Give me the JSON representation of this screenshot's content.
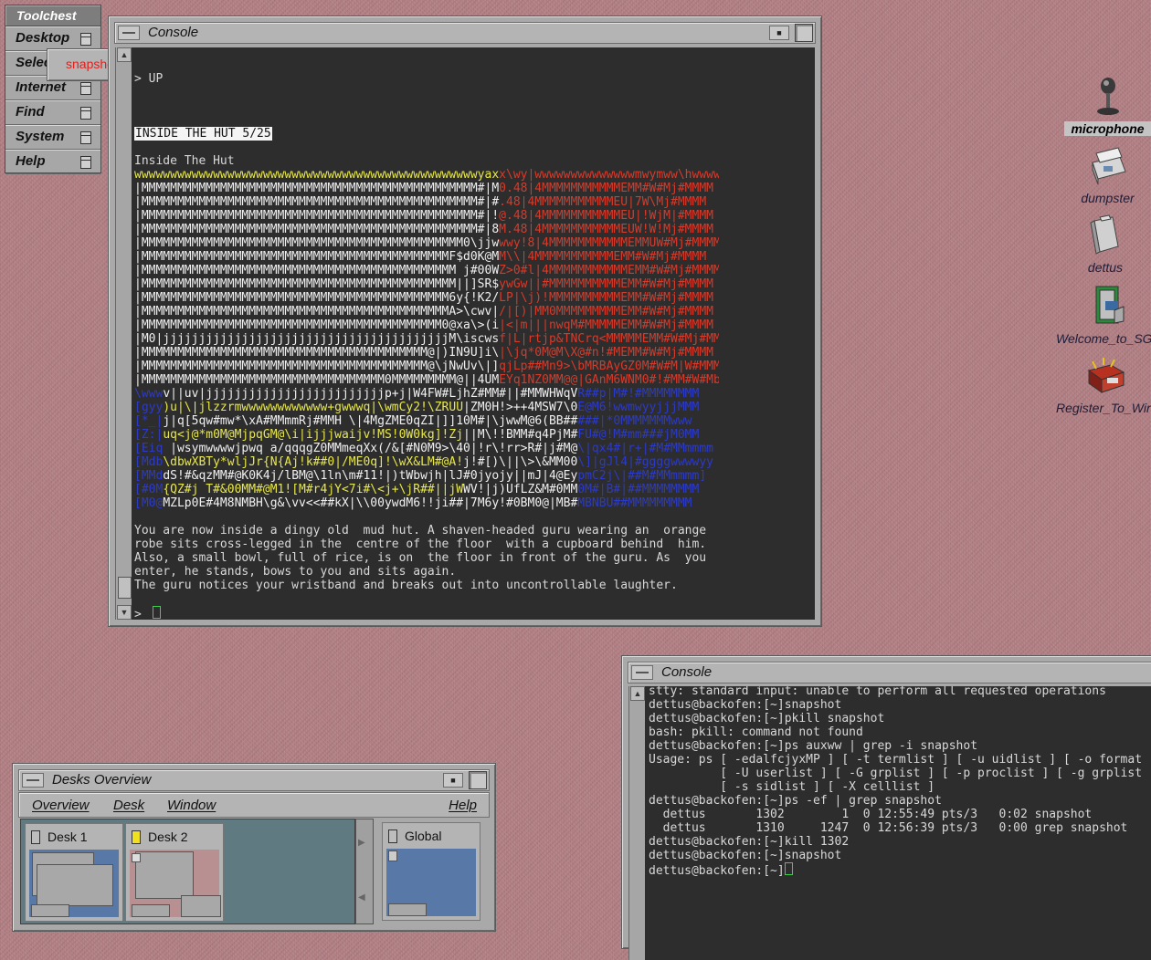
{
  "toolchest": {
    "title": "Toolchest",
    "items": [
      {
        "label": "Desktop"
      },
      {
        "label": "Selected"
      },
      {
        "label": "Internet"
      },
      {
        "label": "Find"
      },
      {
        "label": "System"
      },
      {
        "label": "Help"
      }
    ],
    "submenu_item": "snapshot"
  },
  "console_main": {
    "title": "Console",
    "pre_text": "> UP",
    "room_banner": "INSIDE THE HUT 5/25",
    "room_name": "Inside The Hut",
    "ascii_art": [
      "wwwwwwwwwwwwwwwwwwwwwwwwwwwwwwwwwwwwwwwwwwwwwwwwyaxx\\wy|wwwwwwwwwwwwwwmwymww\\hwwwww",
      "|MMMMMMMMMMMMMMMMMMMMMMMMMMMMMMMMMMMMMMMMMMMMMMM#|M0.48|4MMMMMMMMMMMEMM#W#Mj#MMMM",
      "|MMMMMMMMMMMMMMMMMMMMMMMMMMMMMMMMMMMMMMMMMMMMMMM#|#.48|4MMMMMMMMMMMEU|7W\\Mj#MMMM",
      "|MMMMMMMMMMMMMMMMMMMMMMMMMMMMMMMMMMMMMMMMMMMMMMM#|!@.48|4MMMMMMMMMMMEU|!WjM|#MMMM",
      "|MMMMMMMMMMMMMMMMMMMMMMMMMMMMMMMMMMMMMMMMMMMMMMM#|8M.48|4MMMMMMMMMMMEUW!W!Mj#MMMM",
      "|MMMMMMMMMMMMMMMMMMMMMMMMMMMMMMMMMMMMMMMMMMMMM0\\jjwwwy!8|4MMMMMMMMMMMEMMUW#Mj#MMMM",
      "|MMMMMMMMMMMMMMMMMMMMMMMMMMMMMMMMMMMMMMMMMMMF$d0K@MM\\\\|4MMMMMMMMMMMEMM#W#Mj#MMMM",
      "|MMMMMMMMMMMMMMMMMMMMMMMMMMMMMMMMMMMMMMMMMMMM j#00WZ>0#l|4MMMMMMMMMMMEMM#W#Mj#MMMM",
      "|MMMMMMMMMMMMMMMMMMMMMMMMMMMMMMMMMMMMMMMMMMMM||]SR$ywGw||#MMMMMMMMMMEMM#W#Mj#MMMM",
      "|MMMMMMMMMMMMMMMMMMMMMMMMMMMMMMMMMMMMMMMMMMM6y{!K2/LP|\\j)!MMMMMMMMMMEMM#W#Mj#MMMM",
      "|MMMMMMMMMMMMMMMMMMMMMMMMMMMMMMMMMMMMMMMMMMMA>\\cwv|/|[)|MM0MMMMMMMMMEMM#W#Mj#MMMM",
      "|MMMMMMMMMMMMMMMMMMMMMMMMMMMMMMMMMMMMMMMMMM0@xa\\>(i|<|m|||nwqM#MMMMMEMM#W#Mj#MMMM",
      "|M0|jjjjjjjjjjjjjjjjjjjjjjjjjjjjjjjjjjjjjjjjM\\iscwsf|L|rtjp&TNCrq<MMMMMEMM#W#Mj#MMMM",
      "|MMMMMMMMMMMMMMMMMMMMMMMMMMMMMMMMMMMMMMMM@|)IN9U]i\\|\\jq*0M@M\\X@#n!#MEMM#W#Mj#MMMM",
      "|MMMMMMMMMMMMMMMMMMMMMMMMMMMMMMMMMMMMMMMM@\\jNwUv\\|]qjLp##Mn9>\\bMRBAyGZ0M#W#M|W#MMMM",
      "|MMMMMMMMMMMMMMMMMMMMMMMMMMMMMMMMMM0MMMMMMMMM@||4UMEYq1NZ0MM@@|GAnM6WNM0#!#MM#W#MbWGZ5P@",
      "\\wwwv||uv|jjjjjjjjjjjjjjjjjjjjjjjjjp+j|W4FW#LjhZ#MM#||#MMWHWqVR##p|M#!#MMMMMMMM",
      "[gyy)u|\\|jlzzrmwwwwwwwwwwww+gwwwq|\\wmCy2!\\ZRUU|ZM0H!>++4MSW7\\0E@M6!wwmwyyjjjMMM",
      "[*_|j|q[5qw#mw*\\xA#MMmmRj#MMH \\|4MgZME0qZI|]]10M#|\\jwwM@6(BB#####|*0MMMMMMMwww",
      "[Z:|uq<j@*m0M@MjpqGM@\\i|ijjjwaijv!MS!0W0kg]!Zj||M\\!!BMM#q4PjM#FU#@!M#mm###jM0MM",
      "[Eiq |wsymwwwwjpwq a/qqqgZ0MMmeqXx(/&[#N0M9>\\40|!r\\!rr>R#|j#M@\\|qx4#|r+|#M#MMmmmm",
      "[Mdb\\dbwXBTy*wljJr{N{Aj!k##0|/ME0q]!\\wX&LM#@A!j!#[)\\||\\>\\&MM00\\]|gJl4|#ggggwwwwyy",
      "[MMddS!#&qzMM#@K0K4j/lBM@\\1ln\\m#11!|)tWbwjh|lJ#0jyojy||mJ|4@EypmC2j\\|##M#MMmmmm]",
      "[#0M{QZ#j T#&00MM#@M1![M#r4jY<7i#\\<j+\\jR##||jWWV!|j)UfLZ&M#0MM0M#|B#|##MMMMMMMM",
      "[M0@MZLp0E#4M8NMBH\\g&\\vv<<##kX|\\\\00ywdM6!!ji##|7M6y!#0BM0@|MB#MBNBU##MMMMMMMMM"
    ],
    "description": [
      "You are now inside a dingy old  mud hut. A shaven-headed guru wearing an  orange",
      "robe sits cross-legged in the  centre of the floor  with a cupboard behind  him.",
      "Also, a small bowl, full of rice, is on  the floor in front of the guru. As  you",
      "enter, he stands, bows to you and sits again.",
      "The guru notices your wristband and breaks out into uncontrollable laughter."
    ],
    "prompt": ">"
  },
  "console_small": {
    "title": "Console",
    "lines": [
      "stty: standard input: unable to perform all requested operations",
      "dettus@backofen:[~]snapshot",
      "dettus@backofen:[~]pkill snapshot",
      "bash: pkill: command not found",
      "dettus@backofen:[~]ps auxww | grep -i snapshot",
      "Usage: ps [ -edalfcjyxMP ] [ -t termlist ] [ -u uidlist ] [ -o format",
      "          [ -U userlist ] [ -G grplist ] [ -p proclist ] [ -g grplist",
      "          [ -s sidlist ] [ -X celllist ]",
      "dettus@backofen:[~]ps -ef | grep snapshot",
      "  dettus       1302        1  0 12:55:49 pts/3   0:02 snapshot",
      "  dettus       1310     1247  0 12:56:39 pts/3   0:00 grep snapshot",
      "dettus@backofen:[~]kill 1302",
      "dettus@backofen:[~]snapshot",
      "dettus@backofen:[~]"
    ]
  },
  "desks_overview": {
    "title": "Desks Overview",
    "menus": [
      "Overview",
      "Desk",
      "Window"
    ],
    "help_menu": "Help",
    "desks": [
      {
        "label": "Desk 1"
      },
      {
        "label": "Desk 2"
      }
    ],
    "global_label": "Global"
  },
  "desktop_icons": [
    {
      "label": "microphone"
    },
    {
      "label": "dumpster"
    },
    {
      "label": "dettus"
    },
    {
      "label": "Welcome_to_SGI"
    },
    {
      "label": "Register_To_Win"
    }
  ],
  "colors": {
    "art_yellow": "#e8e84a",
    "art_red": "#d83a2a",
    "art_blue": "#2c3ac8",
    "art_white": "#f0f0f0",
    "cursor_green": "#39d24a",
    "submenu_text": "#e0201c"
  }
}
